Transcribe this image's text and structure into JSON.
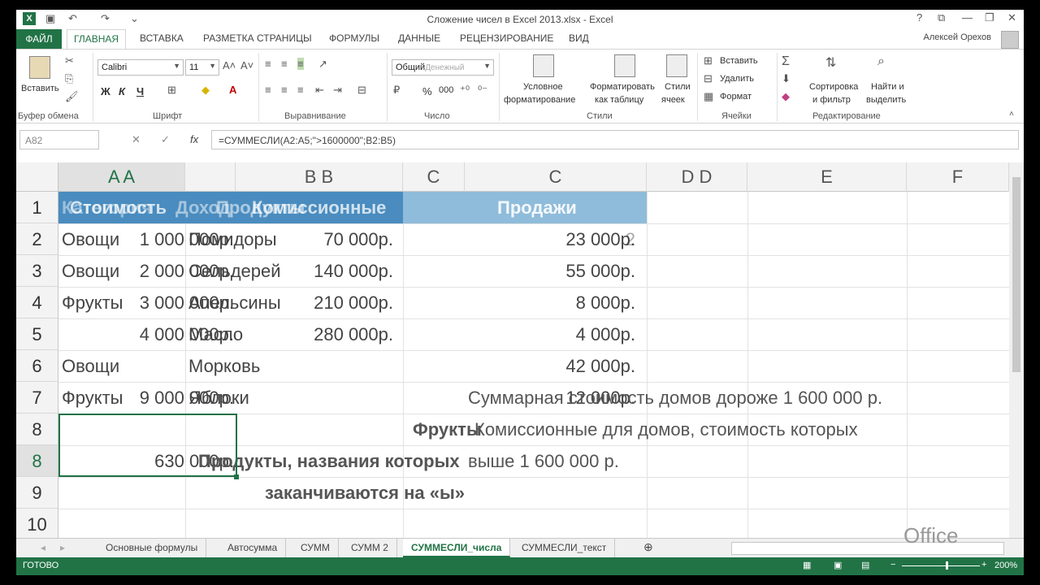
{
  "window": {
    "title": "Сложение чисел в Excel 2013.xlsx - Excel",
    "logo": "X",
    "controls": [
      "?",
      "⧉",
      "—",
      "❐",
      "✕"
    ],
    "quick_access": [
      "💾",
      "↶",
      "↷",
      "⌄"
    ]
  },
  "tabs": {
    "file": "ФАЙЛ",
    "items": [
      "ГЛАВНАЯ",
      "ВСТАВКА",
      "РАЗМЕТКА СТРАНИЦЫ",
      "ФОРМУЛЫ",
      "ДАННЫЕ",
      "РЕЦЕНЗИРОВАНИЕ",
      "ВИД"
    ],
    "active": "ГЛАВНАЯ",
    "user": "Алексей Орехов"
  },
  "ribbon": {
    "clipboard": {
      "label": "Буфер обмена",
      "paste": "Вставить"
    },
    "font": {
      "label": "Шрифт",
      "name": "Calibri",
      "size": "11",
      "bold": "Ж",
      "italic": "К",
      "underline": "Ч"
    },
    "alignment": {
      "label": "Выравнивание"
    },
    "number": {
      "label": "Число",
      "format": "Общий",
      "format_overlay": "Денежный",
      "percent": "%",
      "thousands": "000"
    },
    "styles": {
      "label": "Стили",
      "cond_format_1": "Условное",
      "cond_format_2": "форматирование",
      "table_1": "Форматировать",
      "table_2": "как таблицу",
      "cell_styles_1": "Стили",
      "cell_styles_2": "ячеек"
    },
    "cells": {
      "label": "Ячейки",
      "insert": "Вставить",
      "delete": "Удалить",
      "format": "Формат"
    },
    "editing": {
      "label": "Редактирование",
      "sort_1": "Сортировка",
      "sort_2": "и фильтр",
      "find_1": "Найти и",
      "find_2": "выделить"
    }
  },
  "formula_bar": {
    "name_box": "A82",
    "formula": "=СУММЕСЛИ(A2:A5;\">1600000\";B2:B5)",
    "cancel": "✕",
    "confirm": "✓",
    "fx": "fx"
  },
  "grid": {
    "col_headers": [
      "A  A",
      "B  B",
      "C",
      "C",
      "D  D",
      "E",
      "F"
    ],
    "row_headers": [
      "1",
      "2",
      "3",
      "4",
      "5",
      "6",
      "7",
      "8",
      "8",
      "9",
      "10"
    ],
    "header_row": {
      "ghost_a": "Категория",
      "stoimost": "Стоимость",
      "dohod": "Доход",
      "produkty": "Продукты",
      "komissionnye": "Комиссионные",
      "prodazhi": "Продажи"
    },
    "rows": [
      {
        "a": "Овощи",
        "a_val": "1 000 000р.",
        "b": "Помидоры",
        "b_val": "70 000р.",
        "d": "23 000р.",
        "d_ghost": "2"
      },
      {
        "a": "Овощи",
        "a_val": "2 000 000р.",
        "b": "Сельдерей",
        "b_val": "140 000р.",
        "d": "55 000р."
      },
      {
        "a": "Фрукты",
        "a_val": "3 000 000р.",
        "b": "Апельсины",
        "b_val": "210 000р.",
        "d": "8 000р."
      },
      {
        "a": "",
        "a_val": "4 000 000р.",
        "b": "Масло",
        "b_val": "280 000р.",
        "d": "4 000р."
      },
      {
        "a": "Овощи",
        "a_val": "",
        "b": "Морковь",
        "b_val": "",
        "d": "42 000р."
      },
      {
        "a": "Фрукты",
        "a_val": "9 000 000р.",
        "b": "Яблоки",
        "b_val": "",
        "d": "12 000р."
      }
    ],
    "note_row7": "Суммарная стоимость домов дороже 1 600 000 р.",
    "note_row8a": "Фрукты",
    "note_row8b": "Комиссионные для домов, стоимость которых",
    "total": "630 000р.",
    "note_row8c": "Продукты, названия которых",
    "note_row8d": "выше 1 600 000 р.",
    "note_row9": "заканчиваются на «ы»"
  },
  "sheets": {
    "items": [
      "Основные формулы",
      "Автосумма",
      "СУММ",
      "СУММ 2",
      "СУММЕСЛИ_числа",
      "СУММЕСЛИ_текст"
    ],
    "active": "СУММЕСЛИ_числа",
    "add": "⊕"
  },
  "status": {
    "ready": "ГОТОВО",
    "zoom": "200%"
  },
  "watermark": "Office"
}
